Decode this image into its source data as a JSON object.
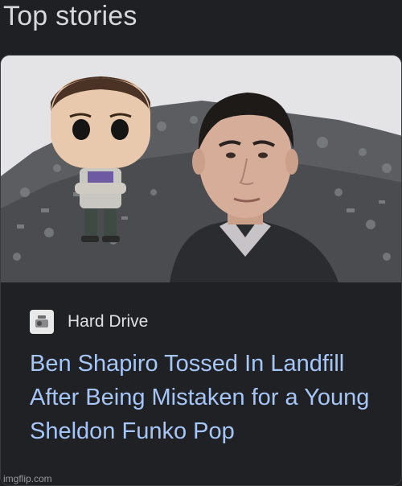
{
  "section": {
    "title": "Top stories"
  },
  "story": {
    "source": {
      "name": "Hard Drive",
      "logo_icon": "hard-drive-logo-icon"
    },
    "headline": "Ben Shapiro Tossed In Landfill After Being Mistaken for a Young Sheldon Funko Pop",
    "thumbnail_icon": "story-thumbnail-image"
  },
  "watermark": {
    "text": "imgflip.com"
  },
  "colors": {
    "background": "#1f2024",
    "headline_link": "#a6c6f7",
    "header_text": "#d8d8db"
  }
}
